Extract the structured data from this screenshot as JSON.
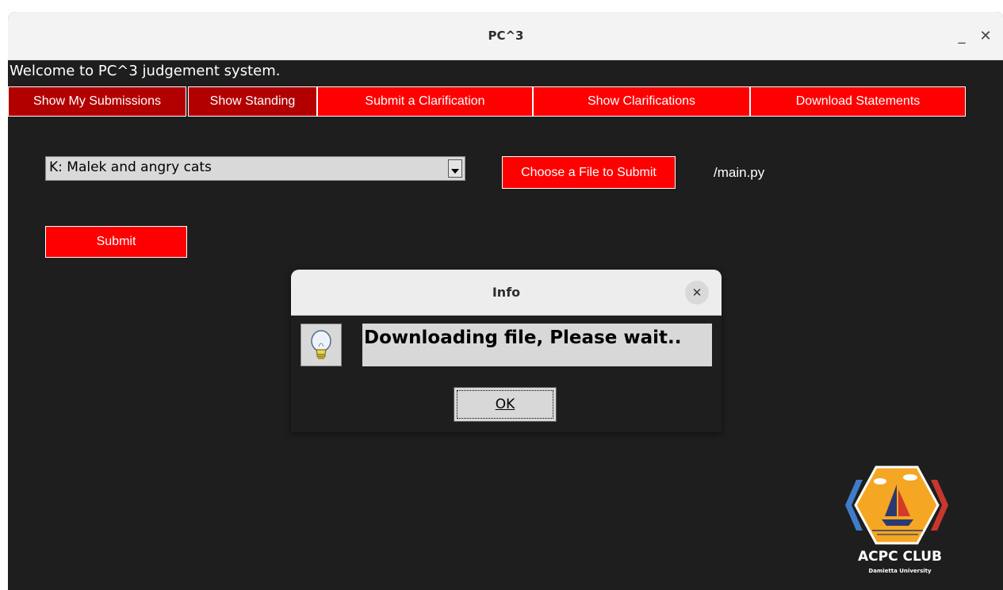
{
  "window": {
    "title": "PC^3",
    "minimize_label": "_",
    "close_label": "✕"
  },
  "welcome_text": "Welcome to PC^3 judgement system.",
  "nav": {
    "items": [
      {
        "label": "Show My Submissions",
        "style": "dark"
      },
      {
        "label": "Show Standing",
        "style": "dark"
      },
      {
        "label": "Submit a Clarification",
        "style": "bright"
      },
      {
        "label": "Show Clarifications",
        "style": "bright"
      },
      {
        "label": "Download Statements",
        "style": "bright"
      }
    ]
  },
  "submission": {
    "problem_selected": "K: Malek and angry cats",
    "choose_file_label": "Choose a File to Submit",
    "file_path": "/main.py",
    "submit_label": "Submit"
  },
  "dialog": {
    "title": "Info",
    "close_label": "✕",
    "icon": "lightbulb-icon",
    "message": "Downloading file, Please wait..",
    "ok_label": "OK"
  },
  "logo": {
    "title": "ACPC CLUB",
    "subtitle": "Damietta University"
  },
  "colors": {
    "background": "#1e1e1e",
    "accent_red": "#ff0000",
    "dark_red": "#b20000"
  }
}
